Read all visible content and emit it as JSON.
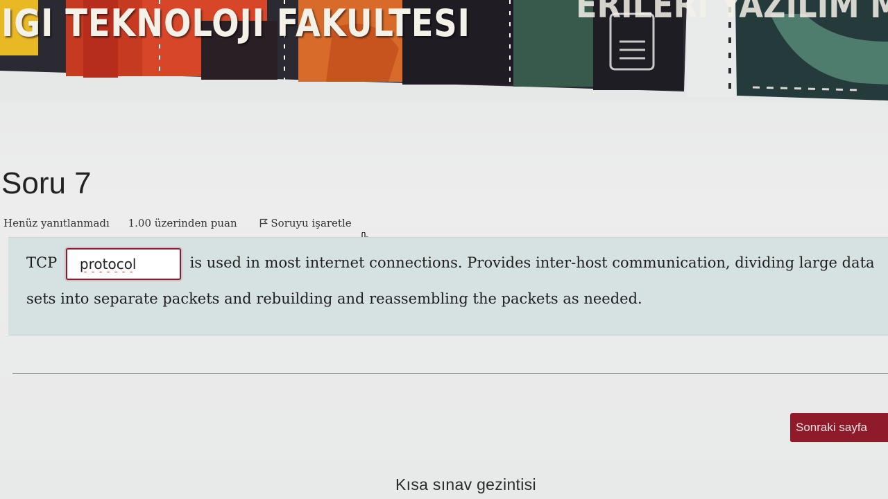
{
  "banner": {
    "title": "IGI TEKNOLOJI FAKULTESI",
    "subtitle": "ERILERI YAZILIM MUHEND"
  },
  "question": {
    "title": "Soru 7",
    "state": "Henüz yanıtlanmadı",
    "grade": "1.00 üzerinden puan",
    "flag_label": "Soruyu işaretle",
    "text_before": "TCP",
    "answer_value": "protocol",
    "text_after": "is used in most internet connections. Provides inter-host communication, dividing large data sets into separate packets and rebuilding and reassembling the packets as needed."
  },
  "footer": {
    "next_button_label": "Sonraki sayfa",
    "quiz_nav_label": "Kısa sınav gezintisi"
  },
  "colors": {
    "accent": "#8f1b2a",
    "question_bg": "#d6e1e1"
  }
}
